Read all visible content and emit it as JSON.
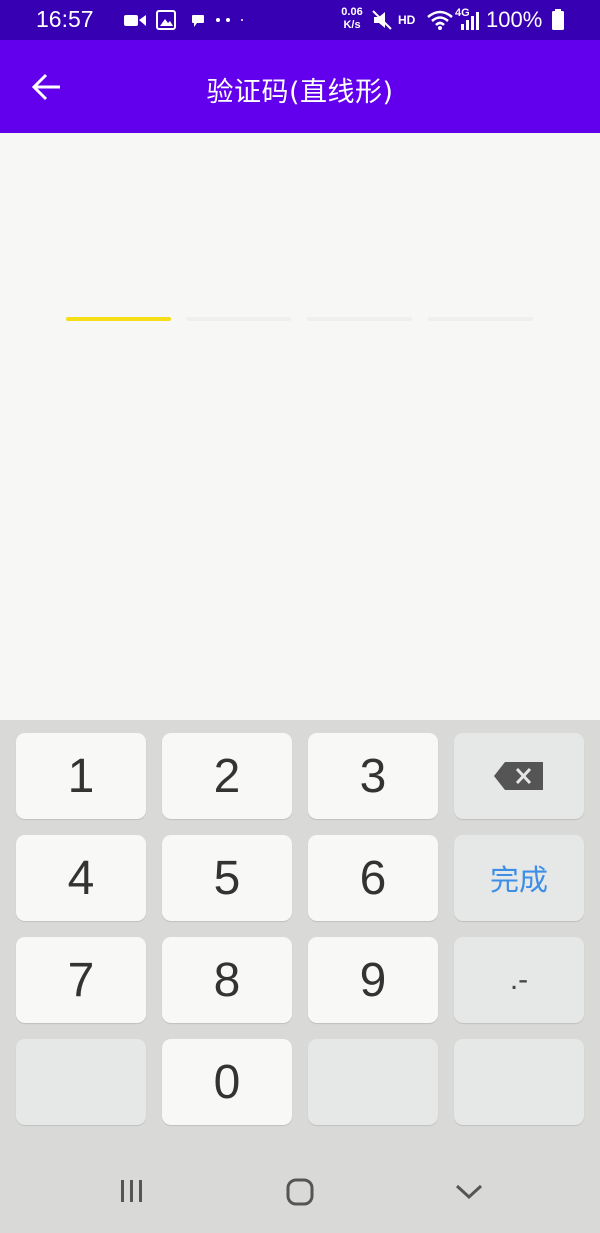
{
  "status_bar": {
    "time": "16:57",
    "net_speed_value": "0.06",
    "net_speed_unit": "K/s",
    "hd_label": "HD",
    "network_label": "4G",
    "battery": "100%"
  },
  "app_bar": {
    "title": "验证码(直线形)",
    "back_icon": "arrow-back-icon"
  },
  "code_input": {
    "slot_count": 4,
    "active_index": 0,
    "active_color": "#f5dd17",
    "inactive_color": "#efefef"
  },
  "keyboard": {
    "keys": {
      "k1": "1",
      "k2": "2",
      "k3": "3",
      "k4": "4",
      "k5": "5",
      "k6": "6",
      "k7": "7",
      "k8": "8",
      "k9": "9",
      "k0": "0",
      "done": "完成",
      "symbol": ".-"
    },
    "backspace_icon": "backspace-icon"
  },
  "nav_bar": {
    "recents_icon": "recents-icon",
    "home_icon": "home-icon",
    "back_icon": "nav-back-icon"
  },
  "colors": {
    "status_bar": "#3700b3",
    "app_bar": "#6200ee",
    "done_text": "#3d8ee6"
  }
}
